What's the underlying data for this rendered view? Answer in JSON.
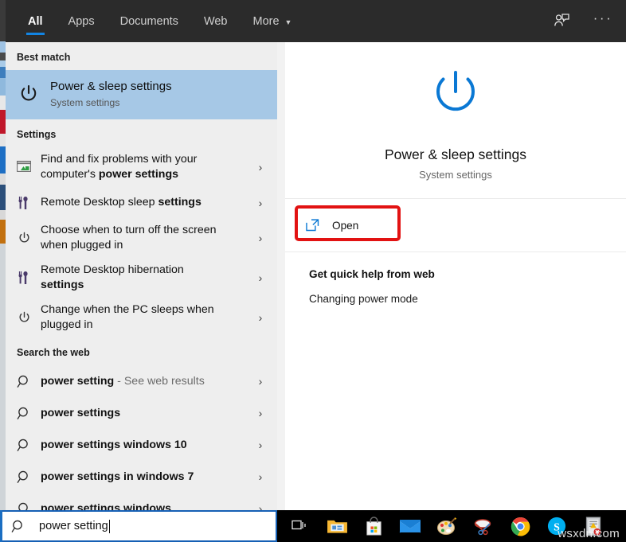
{
  "header": {
    "tabs": [
      {
        "label": "All",
        "active": true
      },
      {
        "label": "Apps",
        "active": false
      },
      {
        "label": "Documents",
        "active": false
      },
      {
        "label": "Web",
        "active": false
      },
      {
        "label": "More",
        "active": false,
        "caret": "▼"
      }
    ],
    "feedback_icon": "feedback-person-icon",
    "more_options": "···",
    "accent_color": "#1285e4",
    "background_color": "#2b2b2b"
  },
  "results": {
    "best_match_heading": "Best match",
    "best_match": {
      "title": "Power & sleep settings",
      "subtitle": "System settings",
      "icon": "power-icon",
      "highlight_color": "#a6c8e6"
    },
    "settings_heading": "Settings",
    "settings_items": [
      {
        "line1": "Find and fix problems with your",
        "line2_pre": "computer's ",
        "line2_bold": "power settings",
        "icon": "troubleshooter-icon",
        "chevron": "›"
      },
      {
        "line1_pre": "Remote Desktop sleep ",
        "line1_bold": "settings",
        "icon": "tools-icon",
        "chevron": "›"
      },
      {
        "line1": "Choose when to turn off the screen",
        "line2": "when plugged in",
        "icon": "power-icon",
        "chevron": "›"
      },
      {
        "line1": "Remote Desktop hibernation",
        "line2_bold": "settings",
        "icon": "tools-icon",
        "chevron": "›"
      },
      {
        "line1": "Change when the PC sleeps when",
        "line2": "plugged in",
        "icon": "power-icon",
        "chevron": "›"
      }
    ],
    "web_heading": "Search the web",
    "web_items": [
      {
        "query": "power setting",
        "suffix": " - See web results",
        "icon": "search-icon",
        "chevron": "›"
      },
      {
        "query": "power settings",
        "suffix": "",
        "icon": "search-icon",
        "chevron": "›"
      },
      {
        "query": "power settings windows 10",
        "suffix": "",
        "icon": "search-icon",
        "chevron": "›"
      },
      {
        "query": "power settings in windows 7",
        "suffix": "",
        "icon": "search-icon",
        "chevron": "›"
      },
      {
        "query": "power settings windows",
        "suffix": "",
        "icon": "search-icon",
        "chevron": "›"
      }
    ]
  },
  "preview": {
    "icon": "power-icon-large",
    "icon_color": "#0a78d4",
    "title": "Power & sleep settings",
    "subtitle": "System settings",
    "open_label": "Open",
    "open_icon": "external-link-icon",
    "highlight_box_color": "#e21212",
    "help_title": "Get quick help from web",
    "help_link": "Changing power mode"
  },
  "search_input": {
    "value": "power setting",
    "icon": "search-icon",
    "border_color": "#1660b5"
  },
  "taskbar": {
    "background_color": "#000000",
    "items": [
      {
        "name": "task-view-icon",
        "label": "Task View"
      },
      {
        "name": "file-explorer-icon",
        "label": "File Explorer"
      },
      {
        "name": "microsoft-store-icon",
        "label": "Microsoft Store"
      },
      {
        "name": "mail-icon",
        "label": "Mail"
      },
      {
        "name": "paint-icon",
        "label": "Paint"
      },
      {
        "name": "snipping-tool-icon",
        "label": "Snipping Tool"
      },
      {
        "name": "chrome-icon",
        "label": "Google Chrome"
      },
      {
        "name": "skype-icon",
        "label": "Skype"
      },
      {
        "name": "app-icon",
        "label": "App"
      }
    ],
    "watermark": "wsxdn.com"
  }
}
